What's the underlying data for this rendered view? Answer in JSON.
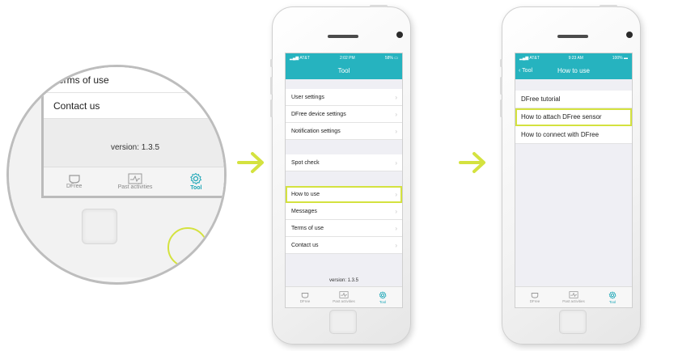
{
  "zoom": {
    "rows": [
      "Terms of use",
      "Contact us"
    ],
    "version": "version: 1.3.5",
    "tabs": [
      "DFree",
      "Past activities",
      "Tool"
    ]
  },
  "phone1": {
    "status": {
      "carrier": "AT&T",
      "time": "2:02 PM",
      "battery": "58%"
    },
    "title": "Tool",
    "group1": [
      "User settings",
      "DFree device settings",
      "Notification settings"
    ],
    "group2": [
      "Spot check"
    ],
    "group3": [
      "How to use",
      "Messages",
      "Terms of use",
      "Contact us"
    ],
    "version": "version: 1.3.5",
    "tabs": [
      "DFree",
      "Past activities",
      "Tool"
    ]
  },
  "phone2": {
    "status": {
      "carrier": "AT&T",
      "time": "9:23 AM",
      "battery": "100%"
    },
    "back": "Tool",
    "title": "How to use",
    "items": [
      "DFree tutorial",
      "How to attach DFree sensor",
      "How to connect with DFree"
    ],
    "tabs": [
      "DFree",
      "Past activities",
      "Tool"
    ]
  },
  "colors": {
    "accent": "#26b3bf",
    "highlight": "#d4e23f"
  }
}
